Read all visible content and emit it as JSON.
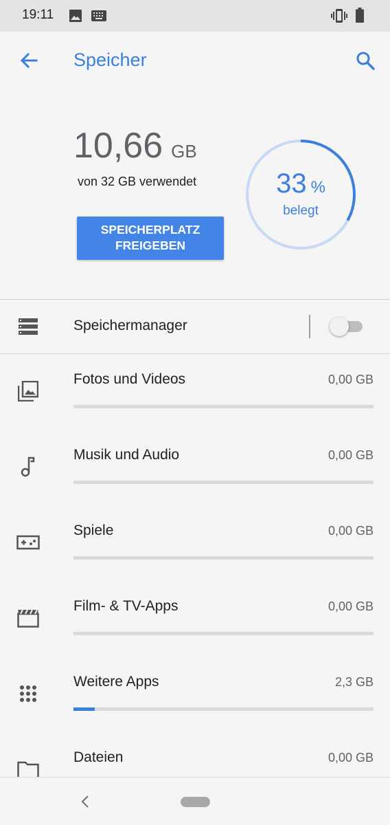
{
  "status_bar": {
    "time": "19:11",
    "icons_left": [
      "image-icon",
      "keyboard-icon"
    ],
    "icons_right": [
      "vibrate-icon",
      "battery-icon"
    ]
  },
  "app_bar": {
    "title": "Speicher",
    "back_icon": "arrow-back-icon",
    "search_icon": "search-icon"
  },
  "summary": {
    "used_value": "10,66",
    "used_unit": "GB",
    "used_of": "von 32 GB verwendet",
    "free_button_line1": "SPEICHERPLATZ",
    "free_button_line2": "FREIGEBEN",
    "percent": "33",
    "percent_symbol": "%",
    "percent_label": "belegt",
    "percent_value": 33
  },
  "storage_manager": {
    "label": "Speichermanager",
    "icon": "storage-list-icon",
    "enabled": false
  },
  "categories": [
    {
      "label": "Fotos und Videos",
      "size": "0,00 GB",
      "icon": "photo-library-icon",
      "fill_fraction": 0
    },
    {
      "label": "Musik und Audio",
      "size": "0,00 GB",
      "icon": "music-note-icon",
      "fill_fraction": 0
    },
    {
      "label": "Spiele",
      "size": "0,00 GB",
      "icon": "gamepad-icon",
      "fill_fraction": 0
    },
    {
      "label": "Film- & TV-Apps",
      "size": "0,00 GB",
      "icon": "movie-clapper-icon",
      "fill_fraction": 0
    },
    {
      "label": "Weitere Apps",
      "size": "2,3 GB",
      "icon": "apps-grid-icon",
      "fill_fraction": 0.07
    },
    {
      "label": "Dateien",
      "size": "0,00 GB",
      "icon": "folder-icon",
      "fill_fraction": 0
    }
  ],
  "nav_bar": {
    "back_icon": "nav-back-icon",
    "home_icon": "home-pill-icon"
  },
  "colors": {
    "accent": "#3d7fdd",
    "button": "#4285e6",
    "ring_track": "#c6d9f5",
    "bar_track": "#dadada"
  }
}
